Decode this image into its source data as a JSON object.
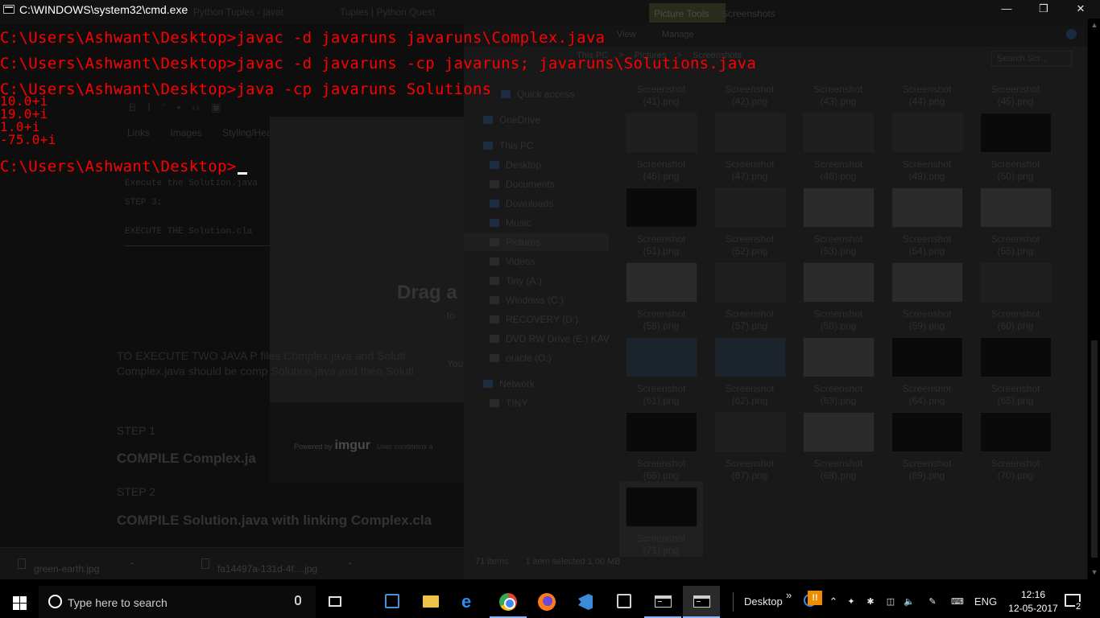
{
  "browser": {
    "tabs": [
      "Python Tuples - javat",
      "Tuples | Python Quest"
    ],
    "toolbar_glyphs": [
      "B",
      "I",
      "“",
      "•",
      "‹›",
      "▣"
    ],
    "editor_links": [
      "Links",
      "Images",
      "Styling/Headers/"
    ],
    "editor_lines": [
      "Execute the Solution.java",
      "STEP 3:",
      "EXECUTE THE Solution.cla"
    ],
    "upload_drag": "Drag a",
    "upload_to": "to",
    "upload_you": "You",
    "powered_by": "Powered by",
    "imgur": "imgur",
    "user_conditions": "User conditions a",
    "article_text": "TO EXECUTE TWO JAVA P files Complex.java and Soluti Complex.java should be comp Solution.java and then Soluti",
    "step1": "STEP 1",
    "compile_complex": "COMPILE Complex.ja",
    "step2": "STEP 2",
    "compile_solution": "COMPILE Solution.java with linking Complex.cla",
    "downloads": [
      {
        "name": "green-earth.jpg"
      },
      {
        "name": "fa14497a-131d-4f....jpg"
      }
    ]
  },
  "explorer": {
    "ribbon_picture_tools": "Picture Tools",
    "ribbon_screenshots": "Screenshots",
    "ribbon_view": "View",
    "ribbon_manage": "Manage",
    "address": [
      "This PC",
      ">",
      "Pictures",
      ">",
      "Screenshots"
    ],
    "search_placeholder": "Search Scr...",
    "nav": [
      {
        "label": "Quick access",
        "color": "#1d2c40"
      },
      {
        "label": "OneDrive",
        "color": "#1d2c40"
      },
      {
        "label": "This PC",
        "color": "#1d2c40"
      },
      {
        "label": "Desktop",
        "color": "#1d2c40"
      },
      {
        "label": "Documents",
        "color": "#2a2a2a"
      },
      {
        "label": "Downloads",
        "color": "#1d2c40"
      },
      {
        "label": "Music",
        "color": "#1d2c40"
      },
      {
        "label": "Pictures",
        "color": "#2a2a2a"
      },
      {
        "label": "Videos",
        "color": "#2a2a2a"
      },
      {
        "label": "Tiny (A:)",
        "color": "#2a2a2a"
      },
      {
        "label": "Windows (C:)",
        "color": "#2a2a2a"
      },
      {
        "label": "RECOVERY (D:)",
        "color": "#2a2a2a"
      },
      {
        "label": "DVD RW Drive (E:) KAV",
        "color": "#2a2a2a"
      },
      {
        "label": "oracle (O:)",
        "color": "#2a2a2a"
      },
      {
        "label": "Network",
        "color": "#1d2c40"
      },
      {
        "label": "TINY",
        "color": "#2a2a2a"
      }
    ],
    "files": [
      {
        "name": "Screenshot",
        "ext": "(41).png",
        "tone": "mid"
      },
      {
        "name": "Screenshot",
        "ext": "(42).png",
        "tone": "mid"
      },
      {
        "name": "Screenshot",
        "ext": "(43).png",
        "tone": "mid"
      },
      {
        "name": "Screenshot",
        "ext": "(44).png",
        "tone": "mid"
      },
      {
        "name": "Screenshot",
        "ext": "(45).png",
        "tone": "mid"
      },
      {
        "name": "Screenshot",
        "ext": "(46).png",
        "tone": "mid"
      },
      {
        "name": "Screenshot",
        "ext": "(47).png",
        "tone": "mid"
      },
      {
        "name": "Screenshot",
        "ext": "(48).png",
        "tone": "mid"
      },
      {
        "name": "Screenshot",
        "ext": "(49).png",
        "tone": "mid"
      },
      {
        "name": "Screenshot",
        "ext": "(50).png",
        "tone": "dark"
      },
      {
        "name": "Screenshot",
        "ext": "(51).png",
        "tone": "dark"
      },
      {
        "name": "Screenshot",
        "ext": "(52).png",
        "tone": "mid"
      },
      {
        "name": "Screenshot",
        "ext": "(53).png",
        "tone": "light"
      },
      {
        "name": "Screenshot",
        "ext": "(54).png",
        "tone": "light"
      },
      {
        "name": "Screenshot",
        "ext": "(55).png",
        "tone": "light"
      },
      {
        "name": "Screenshot",
        "ext": "(56).png",
        "tone": "light"
      },
      {
        "name": "Screenshot",
        "ext": "(57).png",
        "tone": "mid"
      },
      {
        "name": "Screenshot",
        "ext": "(58).png",
        "tone": "light"
      },
      {
        "name": "Screenshot",
        "ext": "(59).png",
        "tone": "light"
      },
      {
        "name": "Screenshot",
        "ext": "(60).png",
        "tone": "mid"
      },
      {
        "name": "Screenshot",
        "ext": "(61).png",
        "tone": "blue"
      },
      {
        "name": "Screenshot",
        "ext": "(62).png",
        "tone": "blue"
      },
      {
        "name": "Screenshot",
        "ext": "(63).png",
        "tone": "light"
      },
      {
        "name": "Screenshot",
        "ext": "(64).png",
        "tone": "dark"
      },
      {
        "name": "Screenshot",
        "ext": "(65).png",
        "tone": "dark"
      },
      {
        "name": "Screenshot",
        "ext": "(66).png",
        "tone": "dark"
      },
      {
        "name": "Screenshot",
        "ext": "(67).png",
        "tone": "mid"
      },
      {
        "name": "Screenshot",
        "ext": "(68).png",
        "tone": "light"
      },
      {
        "name": "Screenshot",
        "ext": "(69).png",
        "tone": "dark"
      },
      {
        "name": "Screenshot",
        "ext": "(70).png",
        "tone": "dark"
      },
      {
        "name": "Screenshot",
        "ext": "(71).png",
        "tone": "dark"
      }
    ],
    "status_items": "71 items",
    "status_selected": "1 item selected  1.00 MB"
  },
  "console": {
    "title": "C:\\WINDOWS\\system32\\cmd.exe",
    "minimize": "—",
    "maximize": "❒",
    "close": "✕",
    "lines": [
      {
        "text": "C:\\Users\\Ashwant\\Desktop>javac -d javaruns javaruns\\Complex.java",
        "kind": "cmd"
      },
      {
        "text": "C:\\Users\\Ashwant\\Desktop>javac -d javaruns -cp javaruns; javaruns\\Solutions.java",
        "kind": "cmd"
      },
      {
        "text": "C:\\Users\\Ashwant\\Desktop>java -cp javaruns Solutions",
        "kind": "cmd"
      },
      {
        "text": "10.0+i",
        "kind": "out"
      },
      {
        "text": "19.0+i",
        "kind": "out"
      },
      {
        "text": "1.0+i",
        "kind": "out"
      },
      {
        "text": "-75.0+i",
        "kind": "out"
      }
    ],
    "prompt": "C:\\Users\\Ashwant\\Desktop>",
    "text_color": "#ff0000"
  },
  "taskbar": {
    "search_placeholder": "Type here to search",
    "desktop_label": "Desktop",
    "desktop_more": "»",
    "tray": {
      "notify_badge": "!!",
      "lang": "ENG",
      "time": "12:16",
      "date": "12-05-2017",
      "action_count": "2"
    },
    "accent": "#8cb4ff"
  }
}
